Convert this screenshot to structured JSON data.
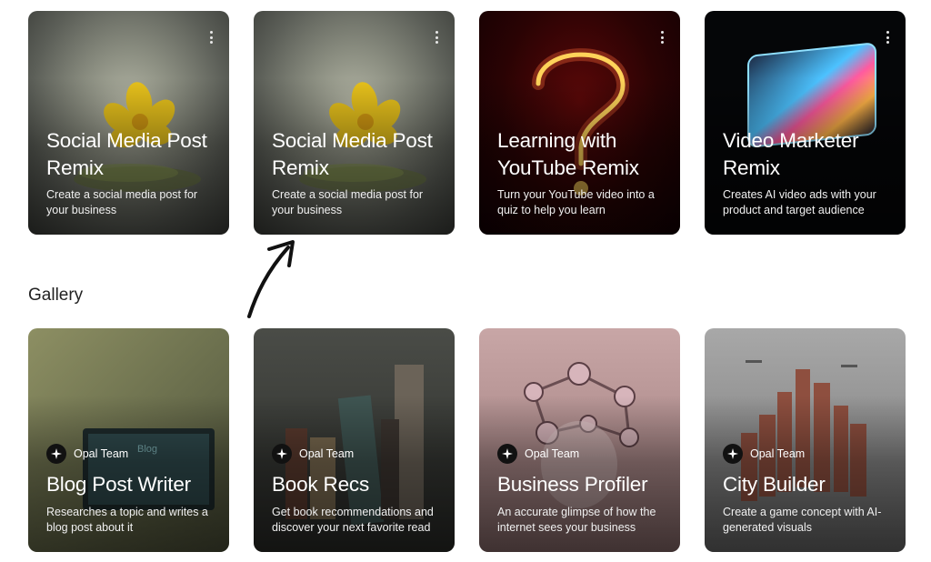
{
  "featured": [
    {
      "title": "Social Media Post Remix",
      "description": "Create a social media post for your business"
    },
    {
      "title": "Social Media Post Remix",
      "description": "Create a social media post for your business"
    },
    {
      "title": "Learning with YouTube Remix",
      "description": "Turn your YouTube video into a quiz to help you learn"
    },
    {
      "title": "Video Marketer Remix",
      "description": "Creates AI video ads with your product and target audience"
    }
  ],
  "gallery_heading": "Gallery",
  "gallery": [
    {
      "author": "Opal Team",
      "title": "Blog Post Writer",
      "description": "Researches a topic and writes a blog post about it"
    },
    {
      "author": "Opal Team",
      "title": "Book Recs",
      "description": "Get book recommendations and discover your next favorite read"
    },
    {
      "author": "Opal Team",
      "title": "Business Profiler",
      "description": "An accurate glimpse of how the internet sees your business"
    },
    {
      "author": "Opal Team",
      "title": "City Builder",
      "description": "Create a game concept with AI-generated visuals"
    }
  ],
  "icons": {
    "menu": "more-vert-icon",
    "author": "sparkle-icon",
    "annotation": "arrow-annotation"
  }
}
